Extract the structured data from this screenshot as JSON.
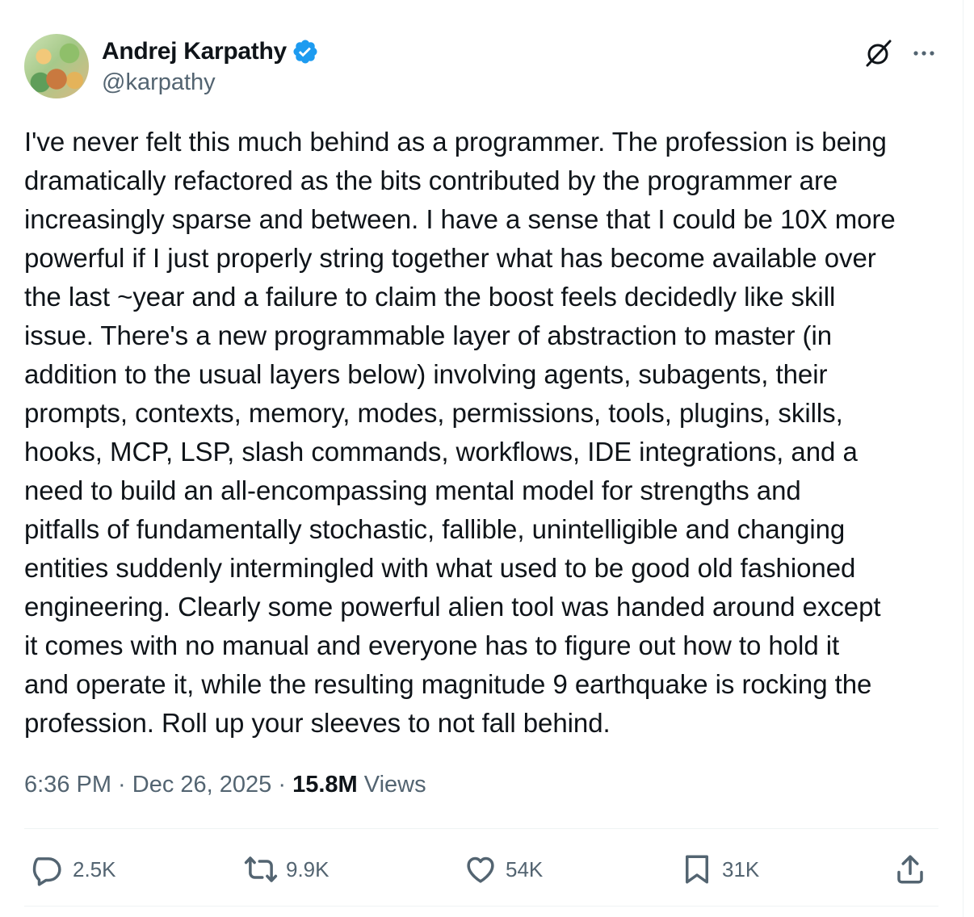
{
  "author": {
    "display_name": "Andrej Karpathy",
    "handle": "@karpathy",
    "verified": true
  },
  "icons": {
    "verified": "verified-badge-icon",
    "grok": "grok-icon",
    "more": "more-icon",
    "reply": "reply-icon",
    "retweet": "retweet-icon",
    "like": "like-icon",
    "bookmark": "bookmark-icon",
    "share": "share-icon"
  },
  "colors": {
    "text": "#0f1419",
    "secondary": "#536471",
    "verified": "#1d9bf0",
    "divider": "#eff3f4"
  },
  "tweet": {
    "text": "I've never felt this much behind as a programmer. The profession is being\ndramatically refactored as the bits contributed by the programmer are\nincreasingly sparse and between. I have a sense that I could be 10X more\npowerful if I just properly string together what has become available over\nthe last ~year and a failure to claim the boost feels decidedly like skill\nissue. There's a new programmable layer of abstraction to master (in\naddition to the usual layers below) involving agents, subagents, their\nprompts, contexts, memory, modes, permissions, tools, plugins, skills,\nhooks, MCP, LSP, slash commands, workflows, IDE integrations, and a\nneed to build an all-encompassing mental model for strengths and\npitfalls of fundamentally stochastic, fallible, unintelligible and changing\nentities suddenly intermingled with what used to be good old fashioned\nengineering. Clearly some powerful alien tool was handed around except\nit comes with no manual and everyone has to figure out how to hold it\nand operate it, while the resulting magnitude 9 earthquake is rocking the\nprofession. Roll up your sleeves to not fall behind."
  },
  "meta": {
    "time": "6:36 PM",
    "date": "Dec 26, 2025",
    "separator": " · ",
    "views_count": "15.8M",
    "views_label": " Views"
  },
  "actions": {
    "reply_count": "2.5K",
    "retweet_count": "9.9K",
    "like_count": "54K",
    "bookmark_count": "31K"
  }
}
